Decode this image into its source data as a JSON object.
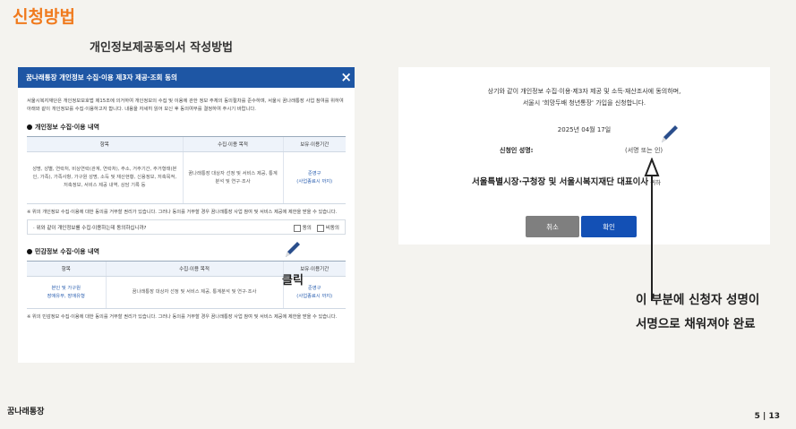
{
  "page": {
    "title": "신청방법",
    "subtitle": "개인정보제공동의서 작성방법",
    "footer_brand": "꿈나래통장",
    "page_number": "5 | 13"
  },
  "form": {
    "header": "꿈나래통장 개인정보 수집·이용 제3자 제공·조회 동의",
    "close_icon": "×",
    "intro": "서울시복지재단은 개인정보보호법 제15조에 의거하여 개인정보의 수집 및 이용에 관한 정보 주체의 동의절차를 준수하며, 서울시 꿈나래통장 사업 참여를 위하여 아래와 같이 개인정보를 수집·이용하고자 합니다. 내용을 자세히 읽어 보신 후 동의여부를 결정하여 주시기 바랍니다.",
    "section1": "개인정보 수집·이용 내역",
    "table1": {
      "headers": [
        "항목",
        "수집·이용 목적",
        "보유·이용기간"
      ],
      "row": [
        "성명, 성별, 연락처, 비상연락(관계, 연락처), 주소, 거주기간, 주거형태(본인, 가족), 가족사항, 가구원 성명, 소득 및 재산현황, 신용정보, 저축목적, 저축정보, 서비스 제공 내역, 상담 기록 등",
        "꿈나래통장 대상자 선정 및 서비스 제공, 통계분석 및 연구·조사",
        "준영구\n(사업종료시 까지)"
      ]
    },
    "note1": "※ 위의 개인정보 수집·이용에 대한 동의를 거부할 권리가 있습니다. 그러나 동의를 거부할 경우 꿈나래통장 사업 참여 및 서비스 제공에 제한을 받을 수 있습니다.",
    "consent_question": "· 위와 같이 개인정보를 수집·이용하는데 동의하십니까?",
    "agree_label": "동의",
    "disagree_label": "비동의",
    "section2": "민감정보 수집·이용 내역",
    "table2": {
      "headers": [
        "항목",
        "수집·이용 목적",
        "보유·이용기간"
      ],
      "row": [
        "본인 및 가구원\n장애유무, 장애유형",
        "꿈나래통장 대상자 선정 및 서비스 제공, 통계분석 및 연구·조사",
        "준영구\n(사업종료시 까지)"
      ]
    },
    "note2": "※ 위의 민감정보 수집·이용에 대한 동의를 거부할 권리가 있습니다. 그러나 동의를 거부할 경우 꿈나래통장 사업 참여 및 서비스 제공에 제한을 받을 수 있습니다."
  },
  "click_label": "클릭",
  "signature": {
    "line1": "상기와 같이 개인정보 수집·이용·제3자 제공 및 소득·재산조사에 동의하며,",
    "line2": "서울시 '희망두배 청년통장' 가입을 신청합니다.",
    "date": "2025년 04월 17일",
    "applicant_label": "신청인 성명:",
    "sign_placeholder": "(서명 또는 인)",
    "org": "서울특별시장·구청장 및 서울시복지재단 대표이사",
    "org_suffix": "귀하",
    "cancel": "취소",
    "confirm": "확인"
  },
  "annotation": {
    "line1": "이 부분에 신청자 성명이",
    "line2": "서명으로 채워져야 완료"
  }
}
